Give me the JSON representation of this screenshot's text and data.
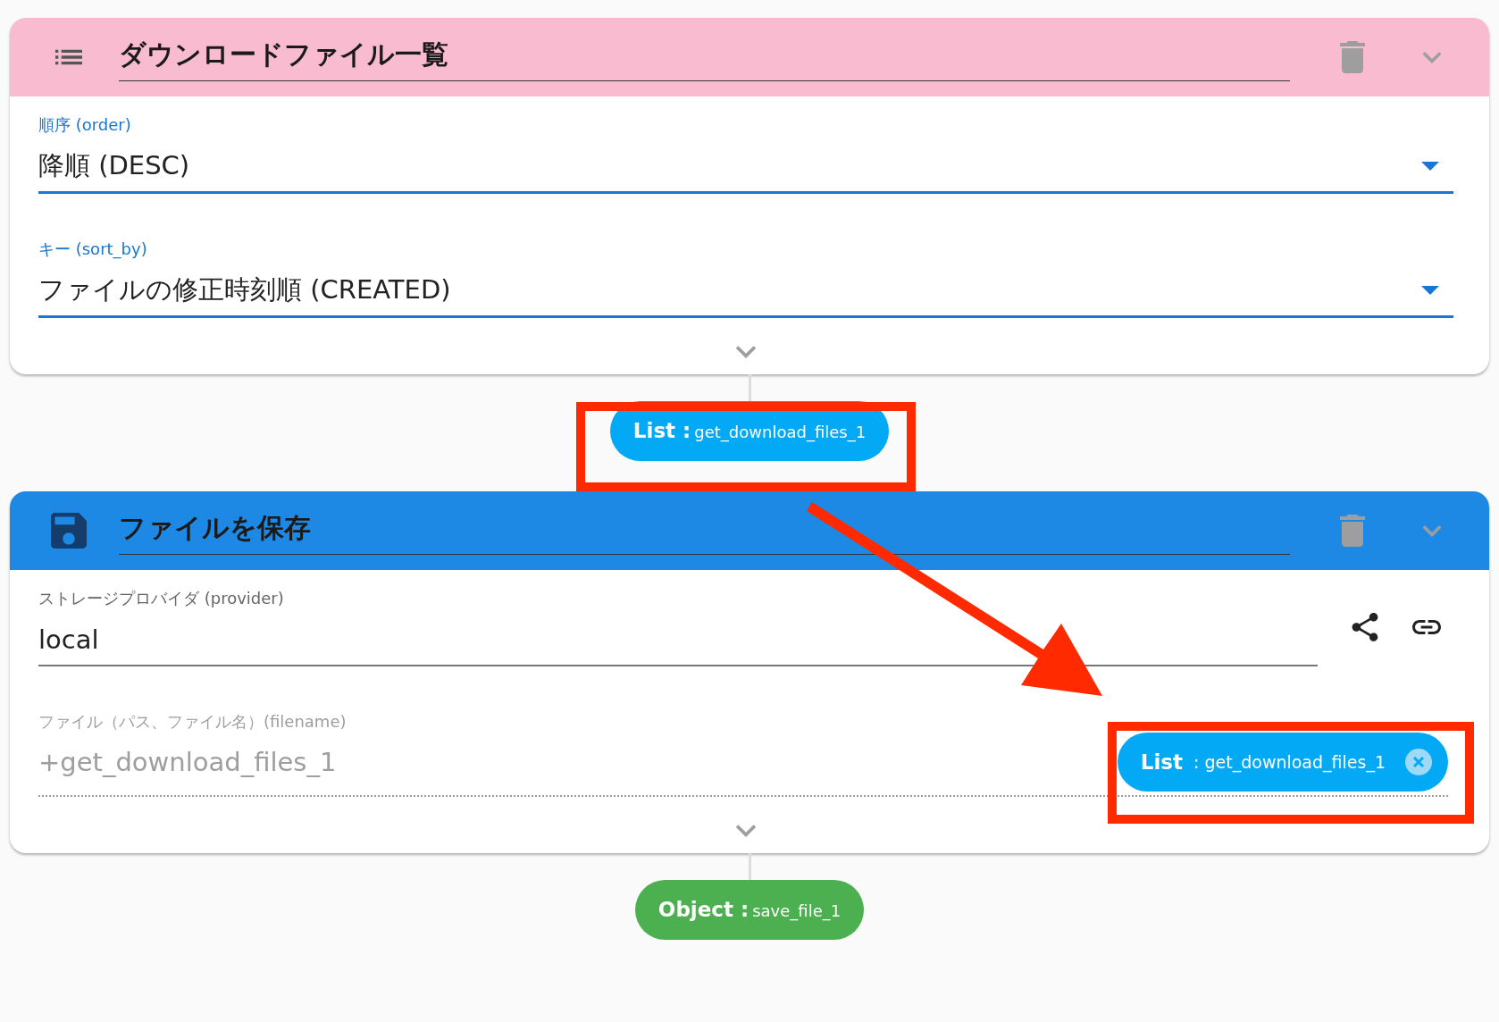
{
  "cards": [
    {
      "kind": "list",
      "color": "#f8bbd0",
      "title": "ダウンロードファイル一覧",
      "fields": [
        {
          "kind": "select",
          "label": "順序 (order)",
          "value": "降順 (DESC)",
          "focused": true
        },
        {
          "kind": "select",
          "label": "キー (sort_by)",
          "value": "ファイルの修正時刻順 (CREATED)",
          "focused": true
        }
      ],
      "output": {
        "type": "List :",
        "name": "get_download_files_1",
        "color": "#03a9f4"
      }
    },
    {
      "kind": "save",
      "color": "#1e88e5",
      "title": "ファイルを保存",
      "fields": [
        {
          "kind": "text",
          "label": "ストレージプロバイダ (provider)",
          "value": "local",
          "focused": false
        },
        {
          "kind": "chips",
          "label": "ファイル（パス、ファイル名）(filename)",
          "placeholder": "+get_download_files_1",
          "chip": {
            "type": "List",
            "name": ": get_download_files_1",
            "color": "#03a9f4"
          }
        }
      ],
      "output": {
        "type": "Object :",
        "name": "save_file_1",
        "color": "#4caf50"
      }
    }
  ]
}
